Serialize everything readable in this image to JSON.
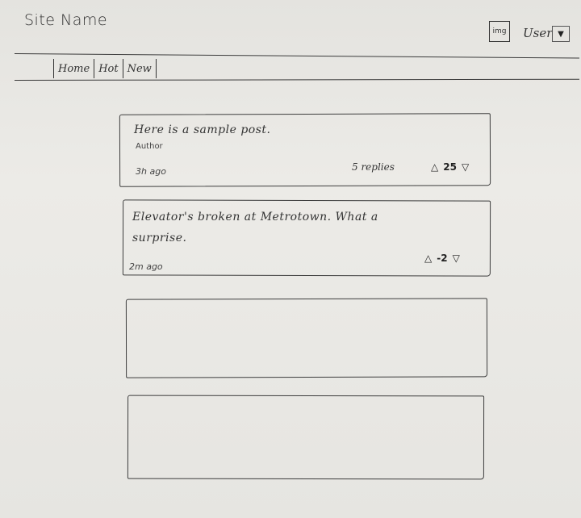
{
  "header": {
    "site_name": "Site Name",
    "img_label": "img",
    "user_label": "User"
  },
  "nav": {
    "tabs": [
      {
        "label": "Home"
      },
      {
        "label": "Hot"
      },
      {
        "label": "New"
      }
    ]
  },
  "posts": [
    {
      "text": "Here is a sample post.",
      "author": "Author",
      "time": "3h ago",
      "replies": "5 replies",
      "score": "25"
    },
    {
      "text_line1": "Elevator's broken at Metrotown. What a",
      "text_line2": "surprise.",
      "time": "2m ago",
      "score": "-2"
    }
  ],
  "icons": {
    "upvote": "upvote-arrow-icon",
    "downvote": "downvote-arrow-icon",
    "dropdown": "triangle-down-icon"
  }
}
